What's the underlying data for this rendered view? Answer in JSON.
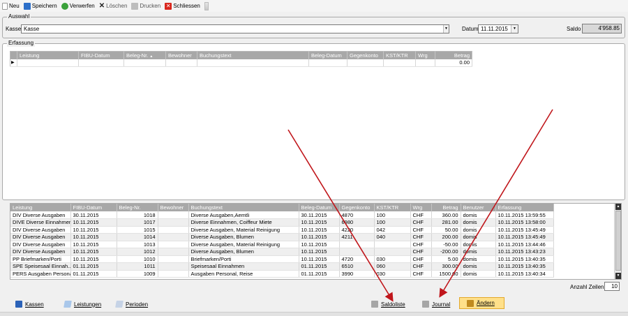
{
  "toolbar": {
    "neu": "Neu",
    "speichern": "Speichern",
    "verwerfen": "Verwerfen",
    "loeschen": "Löschen",
    "drucken": "Drucken",
    "schliessen": "Schliessen"
  },
  "auswahl": {
    "title": "Auswahl",
    "kasse_label": "Kasse",
    "kasse_value": "Kasse",
    "datum_label": "Datum",
    "datum_value": "11.11.2015",
    "saldo_label": "Saldo",
    "saldo_value": "4'958.85"
  },
  "erfassung": {
    "title": "Erfassung",
    "columns": [
      "Leistung",
      "FIBU-Datum",
      "Beleg-Nr.",
      "Bewohner",
      "Buchungstext",
      "Beleg-Datum",
      "Gegenkonto",
      "KST/KTR",
      "Wrg",
      "Betrag"
    ],
    "row_betrag": "0.00",
    "sort_indicator": "▲"
  },
  "journal": {
    "columns": [
      "Leistung",
      "FIBU-Datum",
      "Beleg-Nr.",
      "Bewohner",
      "Buchungstext",
      "Beleg-Datum",
      "Gegenkonto",
      "KST/KTR",
      "Wrg",
      "Betrag",
      "Benutzer",
      "Erfassung"
    ],
    "rows": [
      [
        "DIV Diverse Ausgaben",
        "30.11.2015",
        "1018",
        "",
        "Diverse Ausgaben,Aemtli",
        "30.11.2015",
        "4870",
        "100",
        "CHF",
        "360.00",
        "domis",
        "10.11.2015 13:59:55"
      ],
      [
        "DIVE Diverse Einnahmen",
        "10.11.2015",
        "1017",
        "",
        "Diverse Einnahmen, Coiffeur Miete",
        "10.11.2015",
        "6980",
        "100",
        "CHF",
        "281.00",
        "domis",
        "10.11.2015 13:58:00"
      ],
      [
        "DIV Diverse Ausgaben",
        "10.11.2015",
        "1015",
        "",
        "Diverse Ausgaben, Material Reinigung",
        "10.11.2015",
        "4220",
        "042",
        "CHF",
        "50.00",
        "domis",
        "10.11.2015 13:45:49"
      ],
      [
        "DIV Diverse Ausgaben",
        "10.11.2015",
        "1014",
        "",
        "Diverse Ausgaben, Blumen",
        "10.11.2015",
        "4211",
        "040",
        "CHF",
        "200.00",
        "domis",
        "10.11.2015 13:45:49"
      ],
      [
        "DIV Diverse Ausgaben",
        "10.11.2015",
        "1013",
        "",
        "Diverse Ausgaben, Material Reinigung",
        "10.11.2015",
        "",
        "",
        "CHF",
        "-50.00",
        "domis",
        "10.11.2015 13:44:46"
      ],
      [
        "DIV Diverse Ausgaben",
        "10.11.2015",
        "1012",
        "",
        "Diverse Ausgaben, Blumen",
        "10.11.2015",
        "",
        "",
        "CHF",
        "-200.00",
        "domis",
        "10.11.2015 13:43:23"
      ],
      [
        "PP Briefmarken/Porti",
        "10.11.2015",
        "1010",
        "",
        "Briefmarken/Porti",
        "10.11.2015",
        "4720",
        "030",
        "CHF",
        "5.00",
        "domis",
        "10.11.2015 13:40:35"
      ],
      [
        "SPE Speisesaal Einnah...",
        "01.11.2015",
        "1011",
        "",
        "Speisesaal Einnahmen",
        "01.11.2015",
        "6510",
        "060",
        "CHF",
        "300.00",
        "domis",
        "10.11.2015 13:40:35"
      ],
      [
        "PERS Ausgaben Personal",
        "01.11.2015",
        "1009",
        "",
        "Ausgaben Personal, Reise",
        "01.11.2015",
        "3990",
        "030",
        "CHF",
        "1500.00",
        "domis",
        "10.11.2015 13:40:34"
      ]
    ],
    "anzahl_label": "Anzahl Zeilen",
    "anzahl_value": "10"
  },
  "bottom": {
    "kassen": "Kassen",
    "leistungen": "Leistungen",
    "perioden": "Perioden",
    "saldoliste": "Saldoliste",
    "journal": "Journal",
    "aendern": "Ändern"
  },
  "colors": {
    "header_bg": "#a8a8a8",
    "aendern_bg": "#ffe08a",
    "arrow": "#c0161b"
  }
}
